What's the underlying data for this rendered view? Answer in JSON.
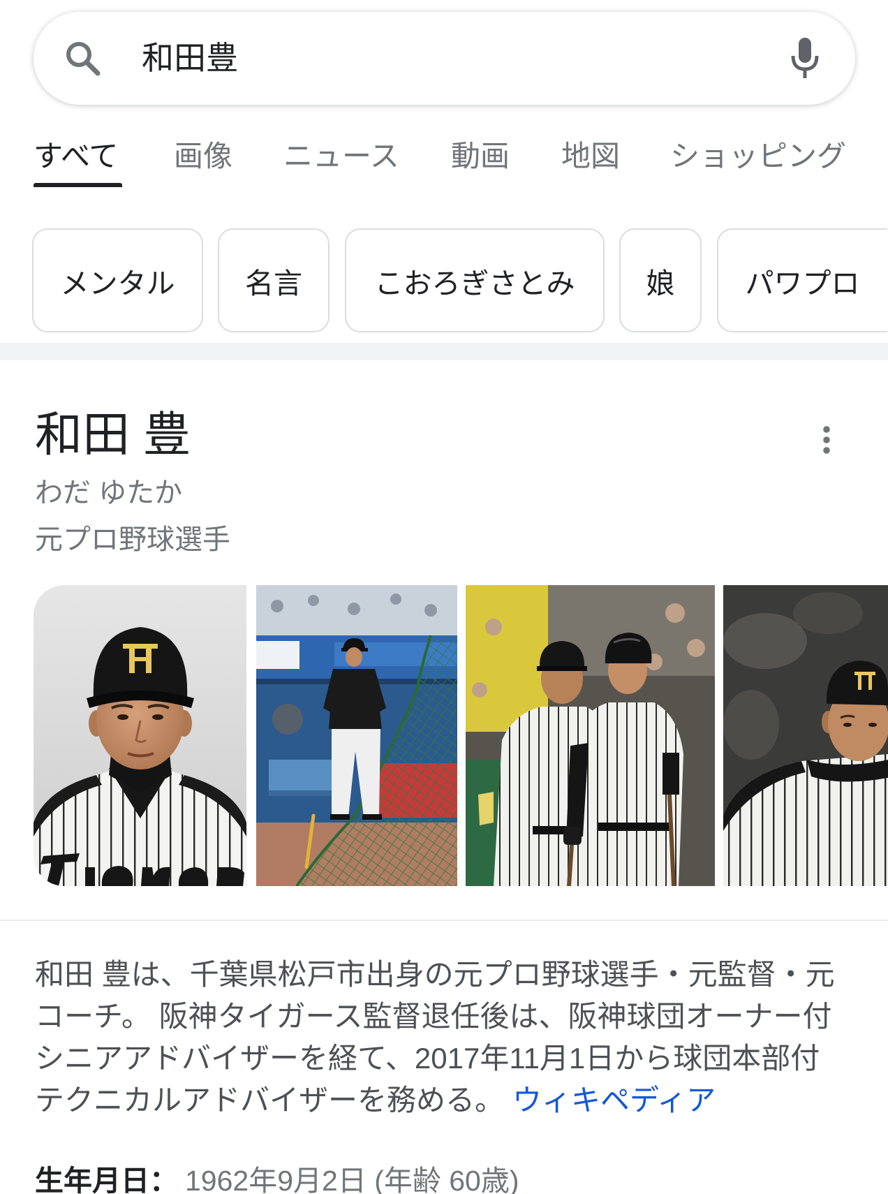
{
  "search": {
    "query": "和田豊"
  },
  "icons": {
    "search": "search-icon",
    "mic": "mic-icon",
    "more": "more-vert-icon"
  },
  "tabs": [
    {
      "label": "すべて",
      "active": true
    },
    {
      "label": "画像"
    },
    {
      "label": "ニュース"
    },
    {
      "label": "動画"
    },
    {
      "label": "地図"
    },
    {
      "label": "ショッピング"
    }
  ],
  "chips": [
    {
      "label": "メンタル"
    },
    {
      "label": "名言"
    },
    {
      "label": "こおろぎさとみ"
    },
    {
      "label": "娘"
    },
    {
      "label": "パワプロ"
    }
  ],
  "panel": {
    "title": "和田 豊",
    "reading": "わだ ゆたか",
    "subtitle": "元プロ野球選手",
    "description": "和田 豊は、千葉県松戸市出身の元プロ野球選手・元監督・元コーチ。 阪神タイガース監督退任後は、阪神球団オーナー付シニアアドバイザーを経て、2017年11月1日から球団本部付テクニカルアドバイザーを務める。",
    "source_link": "ウィキペディア",
    "facts": [
      {
        "label": "生年月日：",
        "value": "1962年9月2日 (年齢 60歳)"
      }
    ]
  },
  "colors": {
    "text": "#202124",
    "secondary": "#70757a",
    "body_text": "#4d5156",
    "link": "#1558d6",
    "band": "#f1f3f4",
    "chip_border": "#dadce0"
  }
}
